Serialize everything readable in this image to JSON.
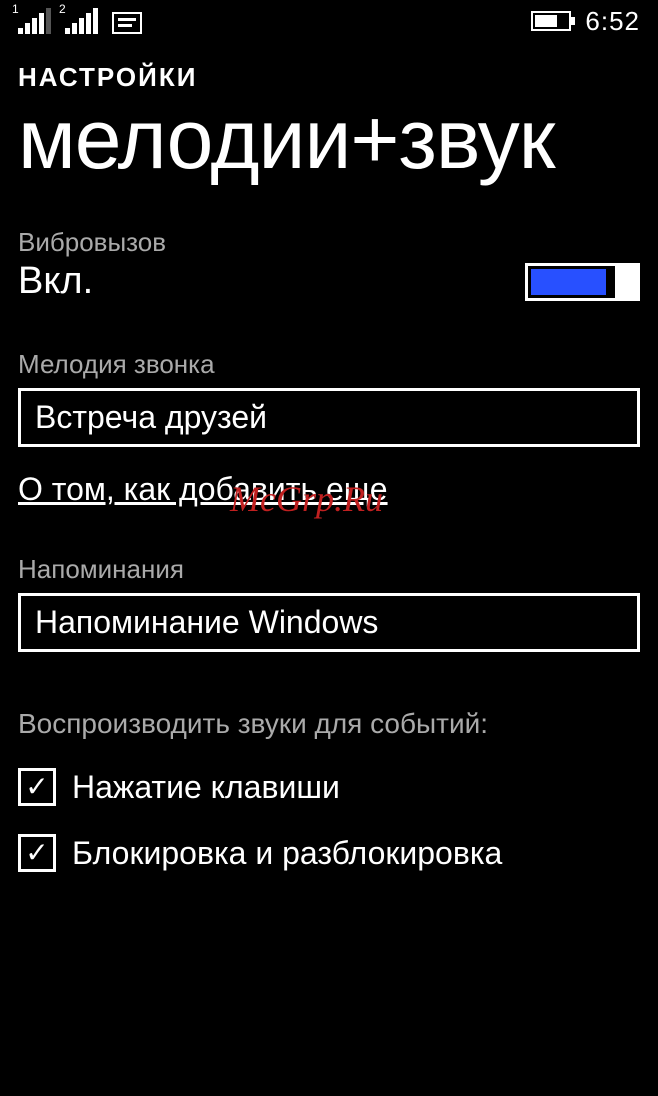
{
  "status": {
    "sim1": "1",
    "sim2": "2",
    "clock": "6:52"
  },
  "breadcrumb": "НАСТРОЙКИ",
  "title": "мелодии+звук",
  "vibrate": {
    "label": "Вибровызов",
    "state": "Вкл."
  },
  "ringtone": {
    "label": "Мелодия звонка",
    "value": "Встреча друзей"
  },
  "add_more_link": "О том, как добавить еще",
  "reminders": {
    "label": "Напоминания",
    "value": "Напоминание Windows"
  },
  "events": {
    "header": "Воспроизводить звуки для событий:",
    "items": [
      {
        "label": "Нажатие клавиши",
        "checked": true
      },
      {
        "label": "Блокировка и разблокировка",
        "checked": true
      }
    ]
  },
  "watermark": "McGrp.Ru"
}
